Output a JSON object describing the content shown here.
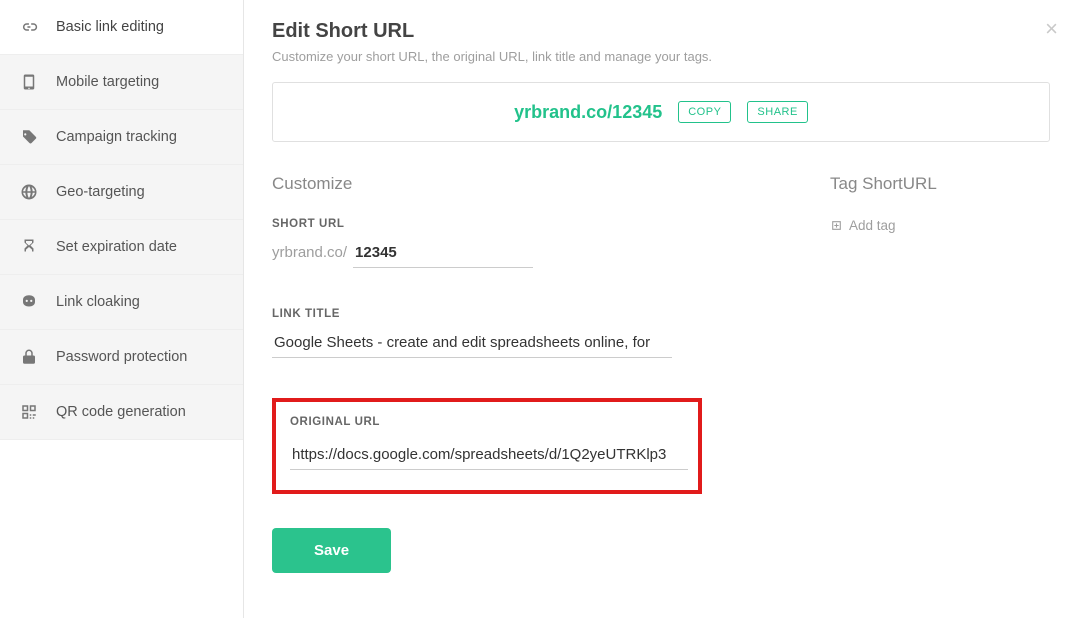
{
  "sidebar": {
    "items": [
      {
        "label": "Basic link editing",
        "icon": "link-icon"
      },
      {
        "label": "Mobile targeting",
        "icon": "phone-icon"
      },
      {
        "label": "Campaign tracking",
        "icon": "tag-icon"
      },
      {
        "label": "Geo-targeting",
        "icon": "globe-icon"
      },
      {
        "label": "Set expiration date",
        "icon": "hourglass-icon"
      },
      {
        "label": "Link cloaking",
        "icon": "mask-icon"
      },
      {
        "label": "Password protection",
        "icon": "lock-icon"
      },
      {
        "label": "QR code generation",
        "icon": "qr-icon"
      }
    ]
  },
  "header": {
    "title": "Edit Short URL",
    "subtitle": "Customize your short URL, the original URL, link title and manage your tags."
  },
  "url_card": {
    "short_url": "yrbrand.co/12345",
    "copy_label": "COPY",
    "share_label": "SHARE"
  },
  "customize": {
    "section_title": "Customize",
    "short_url_label": "SHORT URL",
    "domain_prefix": "yrbrand.co/",
    "slug_value": "12345",
    "link_title_label": "LINK TITLE",
    "link_title_value": "Google Sheets - create and edit spreadsheets online, for",
    "original_url_label": "ORIGINAL URL",
    "original_url_value": "https://docs.google.com/spreadsheets/d/1Q2yeUTRKlp3",
    "save_label": "Save"
  },
  "tags": {
    "section_title": "Tag ShortURL",
    "add_label": "Add tag"
  }
}
